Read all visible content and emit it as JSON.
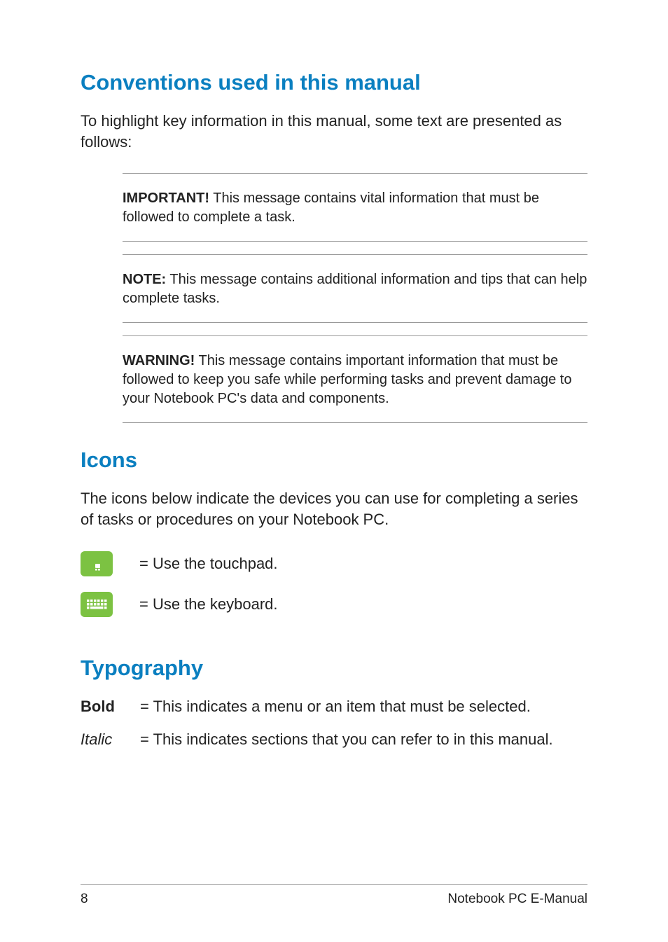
{
  "headings": {
    "conventions": "Conventions used in this manual",
    "icons": "Icons",
    "typography": "Typography"
  },
  "intro": {
    "conventions": "To highlight key information in this manual, some text are presented as follows:",
    "icons": "The icons below indicate the devices you can use for completing a series of tasks or procedures on your Notebook PC."
  },
  "callouts": {
    "important": {
      "label": "IMPORTANT!",
      "text": " This message contains vital information that must be followed to complete a task."
    },
    "note": {
      "label": "NOTE:",
      "text": " This message contains additional information and tips that can help complete tasks."
    },
    "warning": {
      "label": "WARNING!",
      "text": " This message contains important information that must be followed to keep you safe while performing tasks and prevent damage to your Notebook PC's data and components."
    }
  },
  "iconList": {
    "touchpad": "= Use the touchpad.",
    "keyboard": "= Use the keyboard."
  },
  "typographyList": {
    "bold": {
      "term": "Bold",
      "def": "= This indicates a menu or an item that must be selected."
    },
    "italic": {
      "term": "Italic",
      "def": "= This indicates sections that you can refer to in this manual."
    }
  },
  "footer": {
    "page": "8",
    "title": "Notebook PC E-Manual"
  }
}
